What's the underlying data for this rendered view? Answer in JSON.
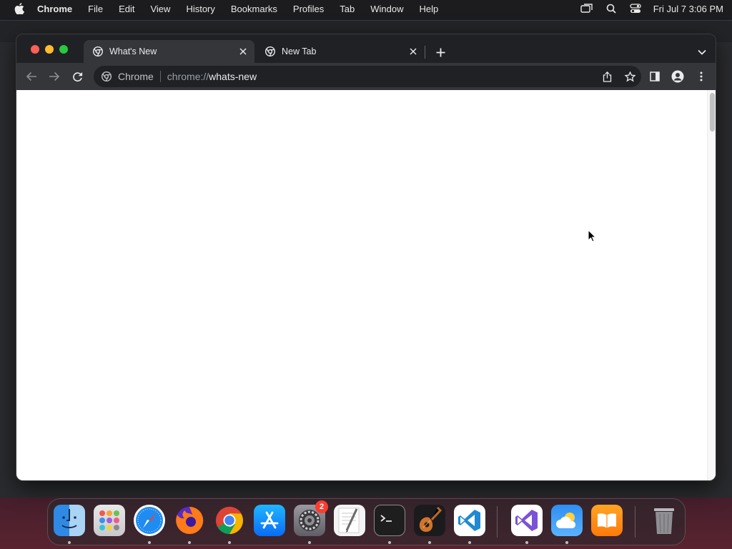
{
  "menubar": {
    "app_name": "Chrome",
    "items": [
      "File",
      "Edit",
      "View",
      "History",
      "Bookmarks",
      "Profiles",
      "Tab",
      "Window",
      "Help"
    ],
    "clock": "Fri Jul 7  3:06 PM"
  },
  "browser": {
    "tabs": [
      {
        "title": "What's New",
        "active": true
      },
      {
        "title": "New Tab",
        "active": false
      }
    ],
    "omnibox": {
      "chip_label": "Chrome",
      "url_scheme": "chrome://",
      "url_host": "whats-new"
    }
  },
  "dock": {
    "apps": [
      "Finder",
      "Launchpad",
      "Safari",
      "Firefox",
      "Google Chrome",
      "App Store",
      "System Settings",
      "TextEdit",
      "Terminal",
      "GarageBand",
      "Visual Studio Code",
      "Visual Studio",
      "Weather",
      "Books",
      "Trash"
    ],
    "system_settings_badge": "2"
  },
  "colors": {
    "accent_blue": "#1a73e8",
    "traffic_red": "#ff5f57",
    "traffic_yellow": "#febc2e",
    "traffic_green": "#28c840"
  }
}
